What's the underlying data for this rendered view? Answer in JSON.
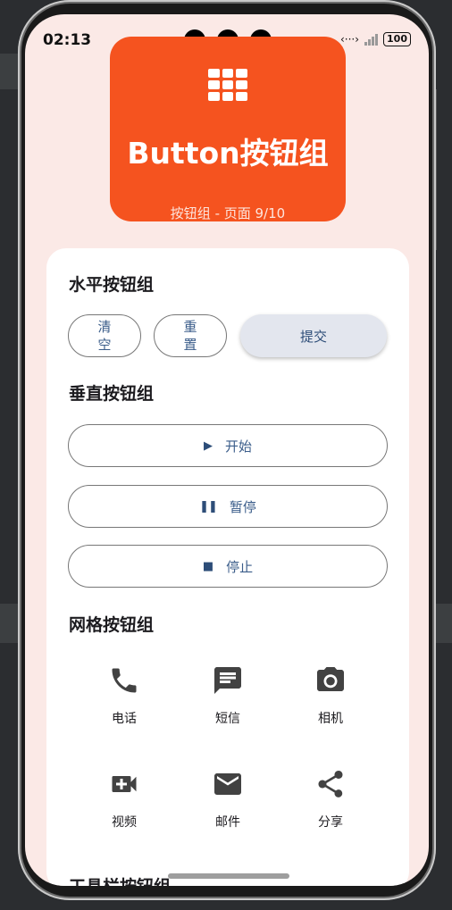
{
  "status": {
    "time": "02:13",
    "battery": "100"
  },
  "hero": {
    "title": "Button按钮组",
    "subtitle": "按钮组 - 页面 9/10"
  },
  "horizontal": {
    "title": "水平按钮组",
    "buttons": [
      "清空",
      "重置",
      "提交"
    ]
  },
  "vertical": {
    "title": "垂直按钮组",
    "buttons": [
      {
        "icon": "play-icon",
        "label": "开始"
      },
      {
        "icon": "pause-icon",
        "label": "暂停"
      },
      {
        "icon": "stop-icon",
        "label": "停止"
      }
    ]
  },
  "grid": {
    "title": "网格按钮组",
    "items": [
      {
        "icon": "phone-icon",
        "label": "电话"
      },
      {
        "icon": "message-icon",
        "label": "短信"
      },
      {
        "icon": "camera-icon",
        "label": "相机"
      },
      {
        "icon": "video-icon",
        "label": "视频"
      },
      {
        "icon": "mail-icon",
        "label": "邮件"
      },
      {
        "icon": "share-icon",
        "label": "分享"
      }
    ]
  },
  "partial_next_title": "工具栏按钮组",
  "colors": {
    "hero": "#f5531f",
    "background": "#fbe9e6",
    "accent_text": "#3b5d8a",
    "icon": "#424242"
  }
}
